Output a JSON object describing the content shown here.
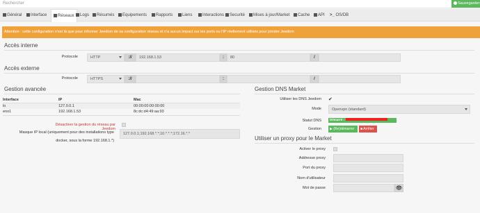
{
  "search": {
    "placeholder": "Rechercher"
  },
  "save_button": {
    "label": "Sauvegarder"
  },
  "tabs": [
    {
      "label": "Général"
    },
    {
      "label": "Interface"
    },
    {
      "label": "Réseaux"
    },
    {
      "label": "Logs"
    },
    {
      "label": "Résumés"
    },
    {
      "label": "Equipements"
    },
    {
      "label": "Rapports"
    },
    {
      "label": "Liens"
    },
    {
      "label": "Interactions"
    },
    {
      "label": "Securité"
    },
    {
      "label": "Mises à jour/Market"
    },
    {
      "label": "Cache"
    },
    {
      "label": "API"
    },
    {
      "label": "OS/DB"
    }
  ],
  "warning": "Attention : cette configuration n'est là que pour informer Jeedom de sa configuration réseau et n'a aucun impact sur les ports ou l'IP réellement utilisés pour joindre Jeedom",
  "internal": {
    "title": "Accès interne",
    "protocol_label": "Protocole",
    "protocol": "HTTP",
    "sep1": "://",
    "host": "192.168.1.53",
    "sep2": ":",
    "port": "80",
    "sep3": "/"
  },
  "external": {
    "title": "Accès externe",
    "protocol_label": "Protocole",
    "protocol": "HTTPS",
    "sep1": "://",
    "sep2": ":",
    "sep3": "/"
  },
  "advanced": {
    "title": "Gestion avancée",
    "headers": [
      "Interface",
      "IP",
      "Mac"
    ],
    "rows": [
      [
        "lo",
        "127.0.0.1",
        "00:00:00:00:00:00"
      ],
      [
        "eno1",
        "192.168.1.53",
        "8c:dc:d4:49:aa:93"
      ]
    ],
    "disable_label": "Désactiver la gestion du réseau par Jeedom",
    "mask_label_1": "Masque IP local (uniquement pour des installations type",
    "mask_label_2": "docker, sous la forme 192.168.1.*)",
    "mask_value": "127.0.0.1;192.168.*.*;10.*.*.*;172.16.*.*"
  },
  "dns": {
    "title": "Gestion DNS Market",
    "use_label": "Utiliser les DNS Jeedom",
    "mode_label": "Mode",
    "mode_value": "Openvpn (standard)",
    "status_label": "Statut DNS",
    "status_value": "Démarré :",
    "manage_label": "Gestion",
    "restart_label": "(Re)démarrer",
    "stop_label": "Arrêter"
  },
  "proxy": {
    "title": "Utiliser un proxy pour le Market",
    "enable_label": "Activer le proxy",
    "address_label": "Addresse proxy",
    "port_label": "Port du proxy",
    "user_label": "Nom d'utilisateur",
    "password_label": "Mot de passe"
  },
  "colors": {
    "accent": "#94ca02",
    "warning": "#f0a23a",
    "success": "#5cb85c",
    "danger": "#d9534f"
  }
}
